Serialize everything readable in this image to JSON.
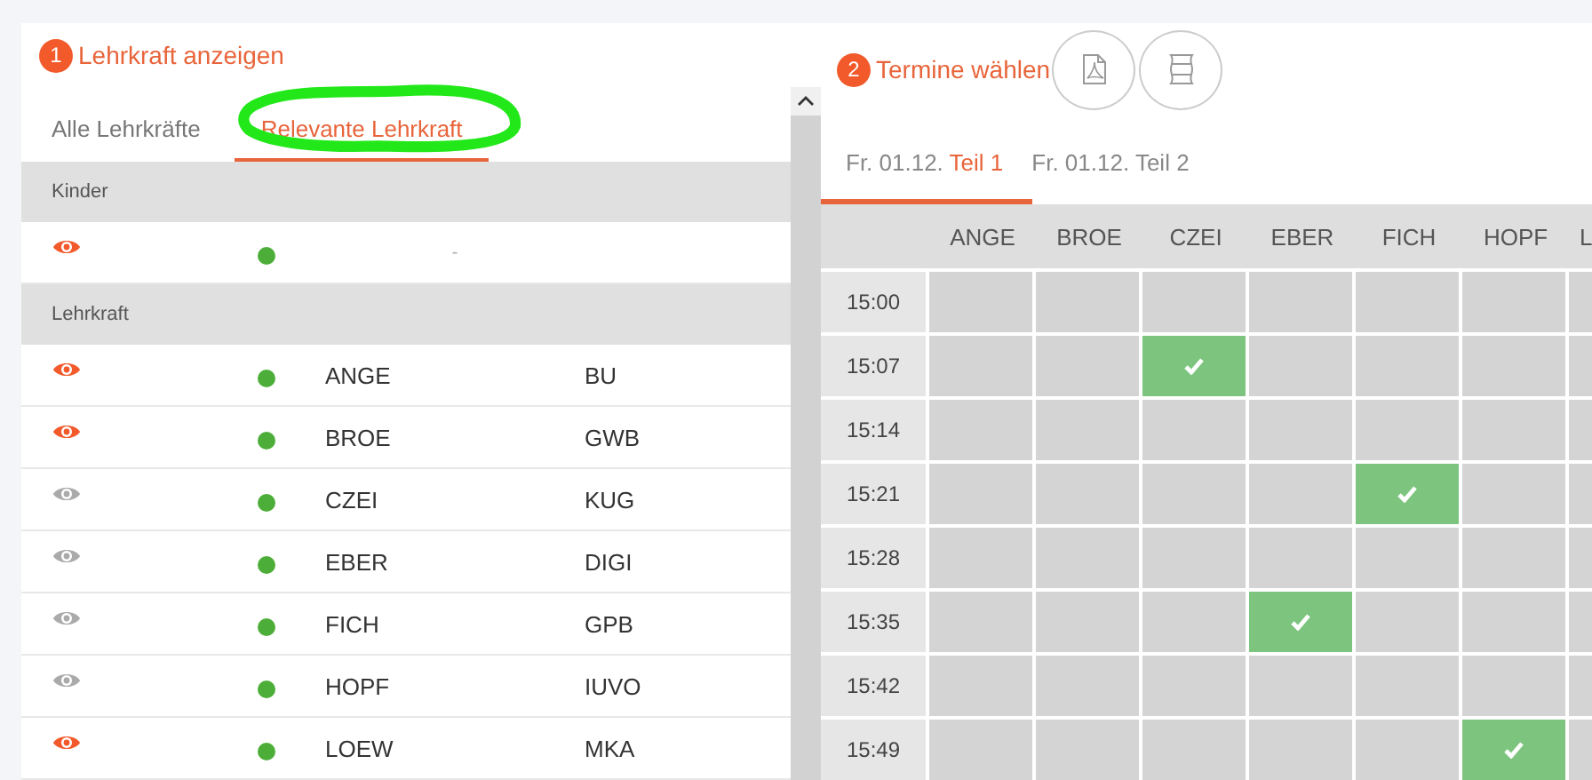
{
  "left_panel": {
    "step": "1",
    "title": "Lehrkraft anzeigen",
    "tabs": [
      {
        "label": "Alle Lehrkräfte",
        "selected": false
      },
      {
        "label": "Relevante Lehrkraft",
        "selected": true
      }
    ],
    "sections": [
      {
        "heading": "Kinder",
        "rows": [
          {
            "kind": "child",
            "visible": true,
            "active": true,
            "name": "-",
            "subject": ""
          }
        ]
      },
      {
        "heading": "Lehrkraft",
        "rows": [
          {
            "kind": "teacher",
            "visible": true,
            "active": true,
            "name": "ANGE",
            "subject": "BU"
          },
          {
            "kind": "teacher",
            "visible": true,
            "active": true,
            "name": "BROE",
            "subject": "GWB"
          },
          {
            "kind": "teacher",
            "visible": false,
            "active": true,
            "name": "CZEI",
            "subject": "KUG"
          },
          {
            "kind": "teacher",
            "visible": false,
            "active": true,
            "name": "EBER",
            "subject": "DIGI"
          },
          {
            "kind": "teacher",
            "visible": false,
            "active": true,
            "name": "FICH",
            "subject": "GPB"
          },
          {
            "kind": "teacher",
            "visible": false,
            "active": true,
            "name": "HOPF",
            "subject": "IUVO"
          },
          {
            "kind": "teacher",
            "visible": true,
            "active": true,
            "name": "LOEW",
            "subject": "MKA"
          }
        ]
      }
    ]
  },
  "right_panel": {
    "step": "2",
    "title": "Termine wählen",
    "tabs": [
      {
        "date": "Fr. 01.12.",
        "part": "Teil 1",
        "selected": true
      },
      {
        "date": "Fr. 01.12.",
        "part": "Teil 2",
        "selected": false
      }
    ],
    "columns": [
      "ANGE",
      "BROE",
      "CZEI",
      "EBER",
      "FICH",
      "HOPF",
      "L"
    ],
    "rows": [
      {
        "time": "15:00",
        "booked": [
          false,
          false,
          false,
          false,
          false,
          false,
          false
        ]
      },
      {
        "time": "15:07",
        "booked": [
          false,
          false,
          true,
          false,
          false,
          false,
          false
        ]
      },
      {
        "time": "15:14",
        "booked": [
          false,
          false,
          false,
          false,
          false,
          false,
          false
        ]
      },
      {
        "time": "15:21",
        "booked": [
          false,
          false,
          false,
          false,
          true,
          false,
          false
        ]
      },
      {
        "time": "15:28",
        "booked": [
          false,
          false,
          false,
          false,
          false,
          false,
          false
        ]
      },
      {
        "time": "15:35",
        "booked": [
          false,
          false,
          false,
          true,
          false,
          false,
          false
        ]
      },
      {
        "time": "15:42",
        "booked": [
          false,
          false,
          false,
          false,
          false,
          false,
          false
        ]
      },
      {
        "time": "15:49",
        "booked": [
          false,
          false,
          false,
          false,
          false,
          true,
          false
        ]
      }
    ]
  }
}
